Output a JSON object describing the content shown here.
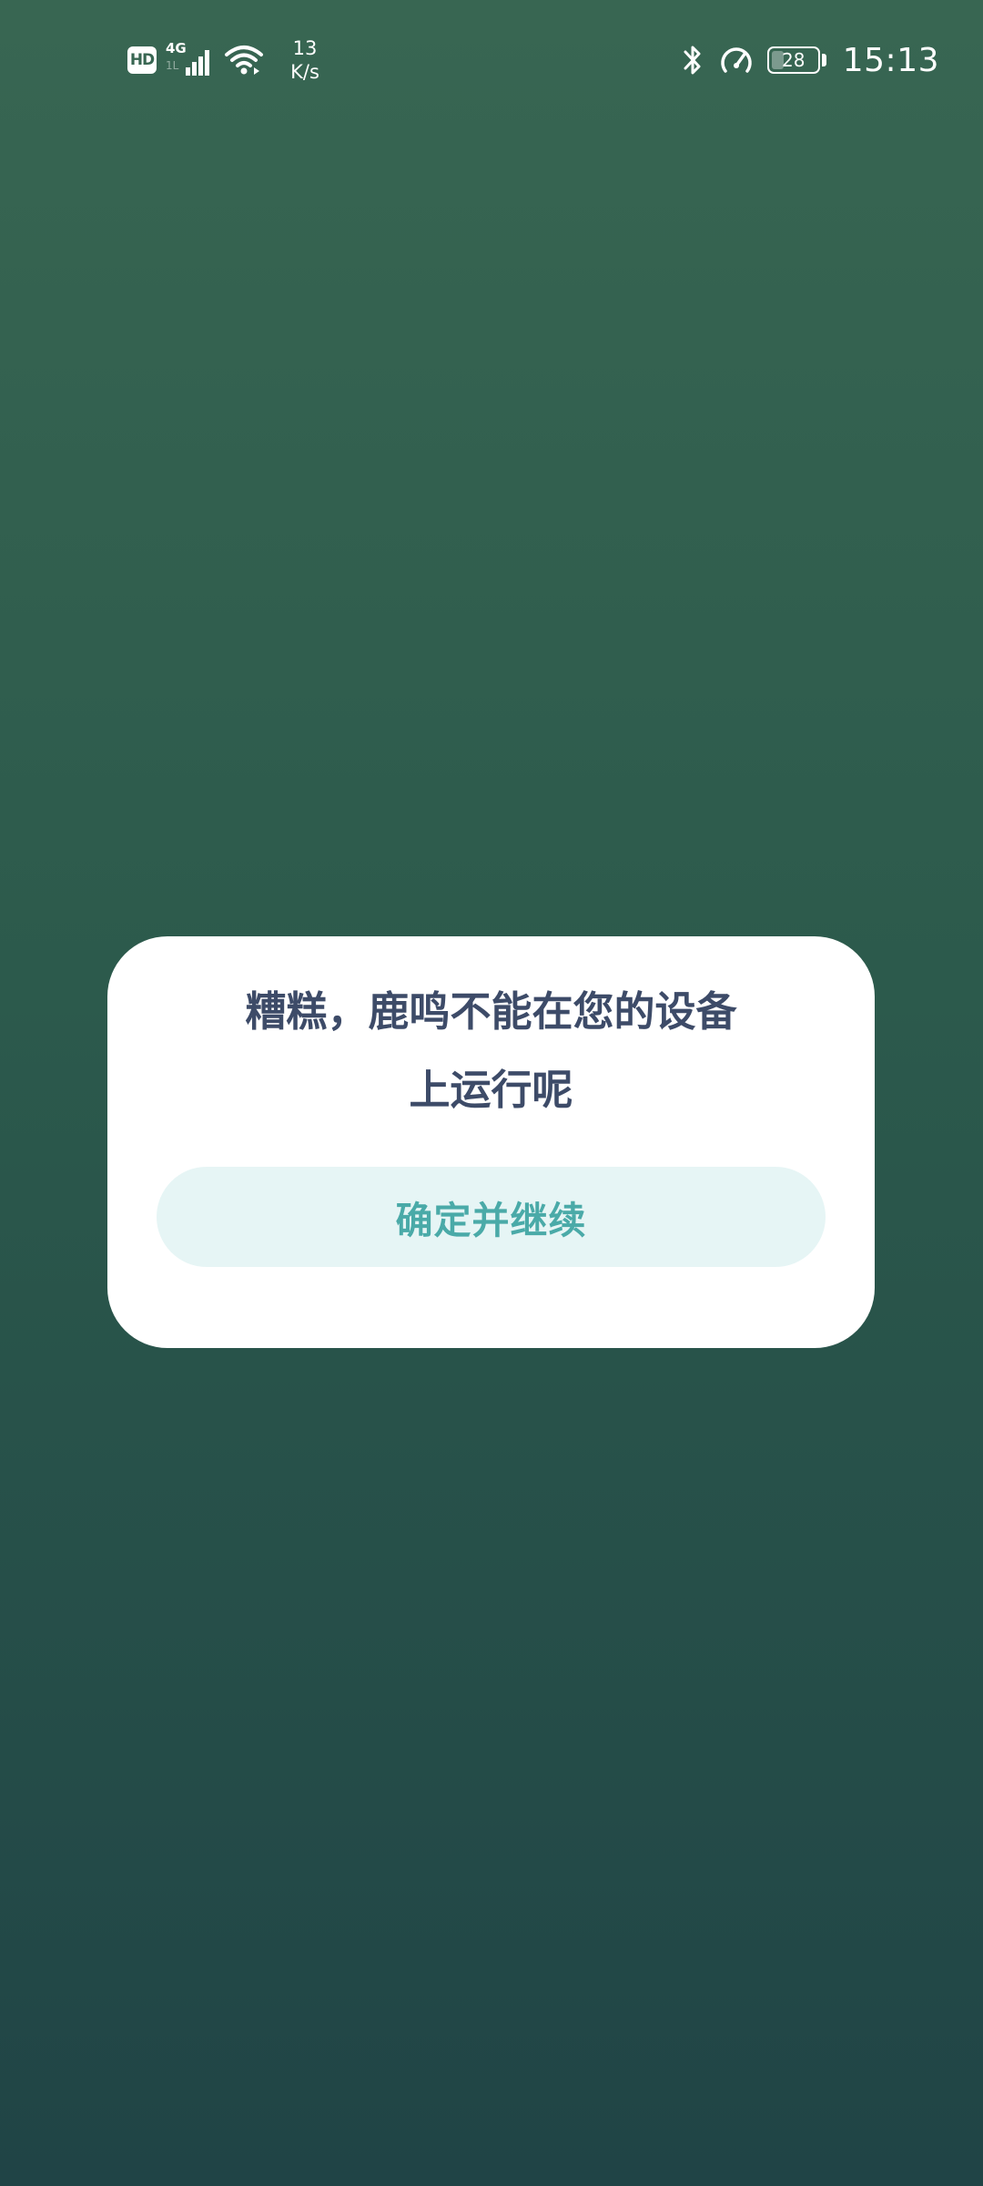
{
  "status_bar": {
    "hd_label": "HD",
    "network_type": "4G",
    "network_sub": "1L",
    "net_speed_value": "13",
    "net_speed_unit": "K/s",
    "battery_level": "28",
    "battery_fraction": 0.28,
    "time": "15:13",
    "icons": [
      "hd-icon",
      "signal-icon",
      "wifi-icon",
      "bluetooth-icon",
      "speedometer-icon",
      "battery-icon"
    ]
  },
  "dialog": {
    "title_line1": "糟糕，鹿鸣不能在您的设备",
    "title_line2": "上运行呢",
    "confirm_label": "确定并继续"
  },
  "colors": {
    "background_top": "#386652",
    "background_bottom": "#204446",
    "dialog_bg": "#ffffff",
    "title_text": "#3d4b68",
    "button_bg": "#e6f5f5",
    "button_text": "#4aaaa8"
  }
}
